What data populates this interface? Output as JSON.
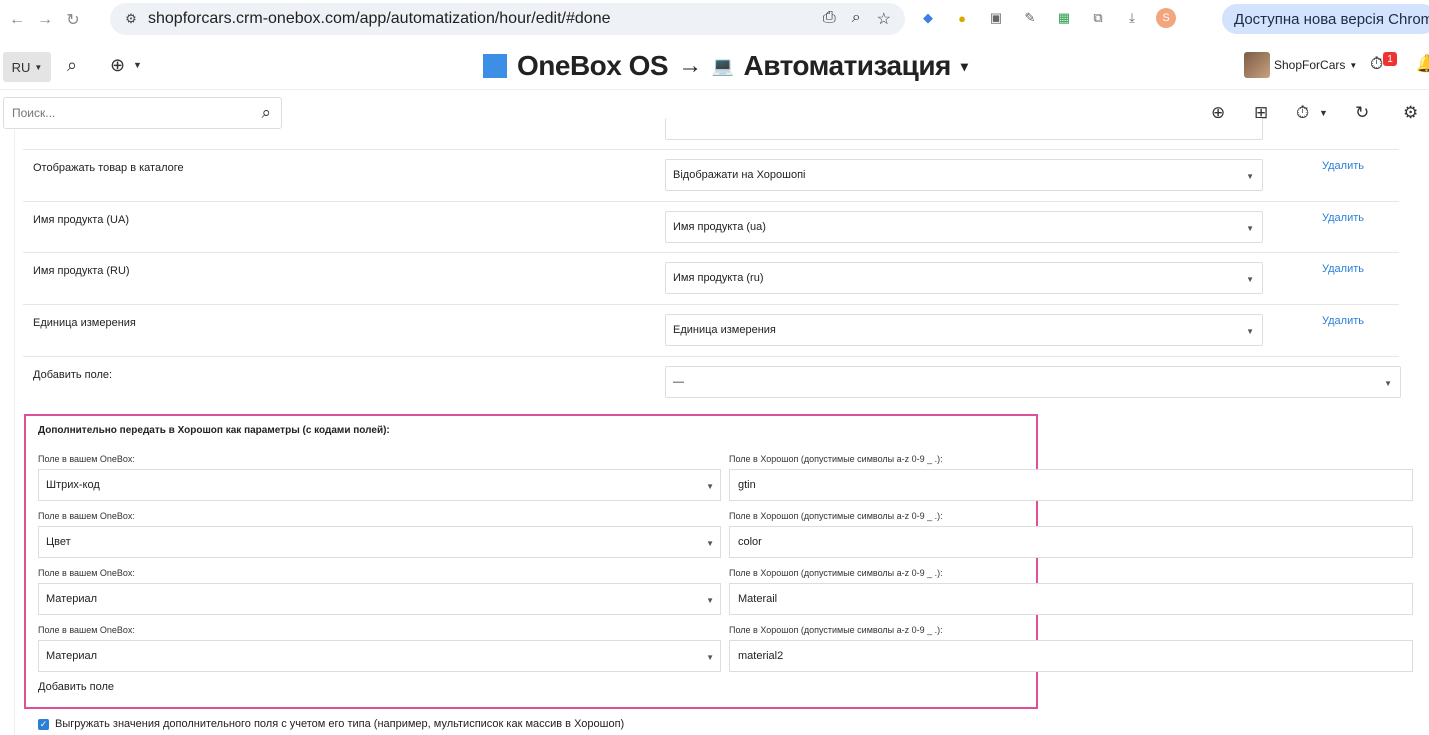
{
  "browser": {
    "url": "shopforcars.crm-onebox.com/app/automatization/hour/edit/#done",
    "update_text": "Доступна нова версія Chrome",
    "profile_initial": "S"
  },
  "header": {
    "lang": "RU",
    "brand": "OneBox OS",
    "arrow": "→",
    "section": "Автоматизация",
    "user": "ShopForCars",
    "notif_count": "1",
    "brand_color": "#3d8fe6"
  },
  "search": {
    "placeholder": "Поиск..."
  },
  "mapping_rows": [
    {
      "label": "Отображать товар в каталоге",
      "value": "Відображати на Хорошопі",
      "delete": "Удалить"
    },
    {
      "label": "Имя продукта (UA)",
      "value": "Имя продукта (ua)",
      "delete": "Удалить"
    },
    {
      "label": "Имя продукта (RU)",
      "value": "Имя продукта (ru)",
      "delete": "Удалить"
    },
    {
      "label": "Единица измерения",
      "value": "Единица измерения",
      "delete": "Удалить"
    }
  ],
  "add_field_row": {
    "label": "Добавить поле:",
    "value": "—"
  },
  "extra_params": {
    "title": "Дополнительно передать в Хорошоп как параметры (с кодами полей):",
    "onebox_label": "Поле в вашем OneBox:",
    "horoshop_label": "Поле в Хорошоп (допустимые символы a-z 0-9 _ .):",
    "items": [
      {
        "onebox": "Штрих-код",
        "horoshop": "gtin"
      },
      {
        "onebox": "Цвет",
        "horoshop": "color"
      },
      {
        "onebox": "Материал",
        "horoshop": "Materail"
      },
      {
        "onebox": "Материал",
        "horoshop": "material2"
      }
    ],
    "add_link": "Добавить поле",
    "highlight_color": "#e04f9a"
  },
  "checkbox": {
    "label": "Выгружать значения дополнительного поля с учетом его типа (например, мультисписок как массив в Хорошоп)",
    "checked": true
  }
}
